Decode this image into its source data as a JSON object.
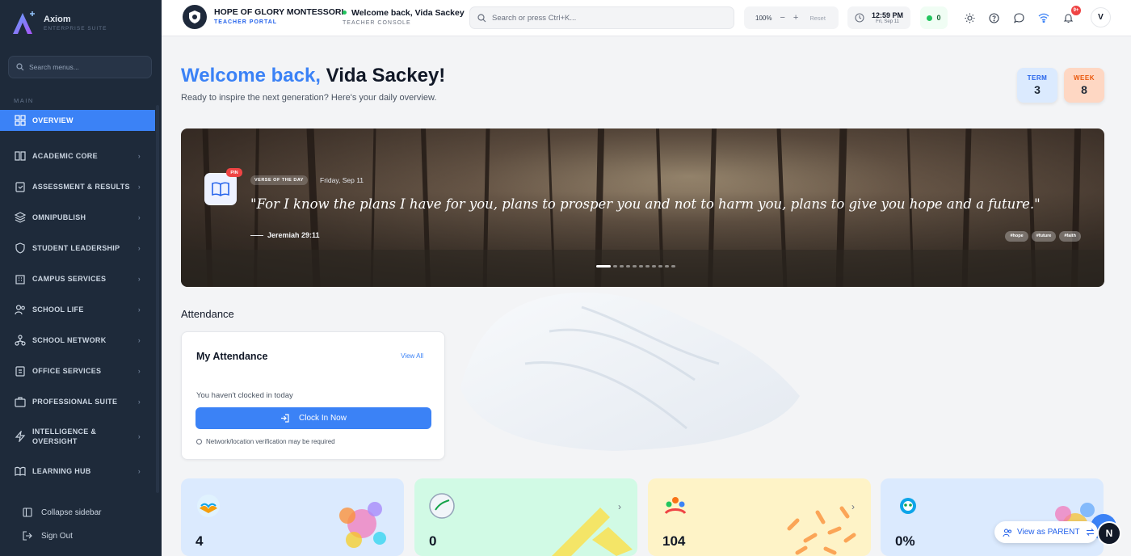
{
  "sidebar": {
    "brand_name": "Axiom",
    "brand_sub": "ENTERPRISE SUITE",
    "search_placeholder": "Search menus...",
    "section_label": "MAIN",
    "items": [
      {
        "label": "OVERVIEW",
        "icon": "grid-icon"
      },
      {
        "label": "ACADEMIC CORE",
        "icon": "book-icon"
      },
      {
        "label": "ASSESSMENT & RESULTS",
        "icon": "clipboard-icon"
      },
      {
        "label": "OMNIPUBLISH",
        "icon": "layers-icon"
      },
      {
        "label": "STUDENT LEADERSHIP",
        "icon": "shield-icon"
      },
      {
        "label": "CAMPUS SERVICES",
        "icon": "building-icon"
      },
      {
        "label": "SCHOOL LIFE",
        "icon": "users-icon"
      },
      {
        "label": "SCHOOL NETWORK",
        "icon": "network-icon"
      },
      {
        "label": "OFFICE SERVICES",
        "icon": "clipboard-check-icon"
      },
      {
        "label": "PROFESSIONAL SUITE",
        "icon": "briefcase-icon"
      },
      {
        "label_line1": "INTELLIGENCE &",
        "label_line2": "OVERSIGHT",
        "icon": "zap-icon"
      },
      {
        "label": "LEARNING HUB",
        "icon": "book-open-icon"
      }
    ],
    "collapse_label": "Collapse sidebar",
    "signout_label": "Sign Out"
  },
  "header": {
    "school_name": "HOPE OF GLORY MONTESSORI",
    "portal": "TEACHER PORTAL",
    "welcome": "Welcome back, Vida Sackey",
    "console": "TEACHER CONSOLE",
    "search_placeholder": "Search or press Ctrl+K...",
    "zoom": "100%",
    "zoom_minus": "−",
    "zoom_plus": "+",
    "zoom_reset": "Reset",
    "time": "12:59 PM",
    "date": "Fri, Sep 11",
    "online_count": "0",
    "notif_badge": "9+",
    "avatar_letter": "V"
  },
  "main": {
    "greeting": "Welcome back,",
    "name": "Vida Sackey!",
    "subtitle": "Ready to inspire the next generation? Here's your daily overview.",
    "term_label": "TERM",
    "term_value": "3",
    "week_label": "WEEK",
    "week_value": "8"
  },
  "verse": {
    "pin": "PIN",
    "tag": "VERSE OF THE DAY",
    "date": "Friday, Sep 11",
    "text": "\"For I know the plans I have for you, plans to prosper you and not to harm you, plans to give you hope and a future.\"",
    "reference": "Jeremiah 29:11",
    "hashtags": [
      "#hope",
      "#future",
      "#faith"
    ]
  },
  "attendance": {
    "section_title": "Attendance",
    "card_title": "My Attendance",
    "view_all": "View All",
    "message": "You haven't clocked in today",
    "button": "Clock In Now",
    "note": "Network/location verification may be required"
  },
  "stats": [
    {
      "value": "4",
      "bg": "#dbeafe"
    },
    {
      "value": "0",
      "bg": "#d1fae5"
    },
    {
      "value": "104",
      "bg": "#fef3c7"
    },
    {
      "value": "0%",
      "bg": "#dbeafe"
    }
  ],
  "floating": {
    "view_as": "View as PARENT",
    "n_letter": "N"
  },
  "colors": {
    "accent": "#3b82f6",
    "sidebar_bg": "#1e2a3a",
    "term_chip": "#dbeafe",
    "week_chip": "#fed7c3"
  }
}
